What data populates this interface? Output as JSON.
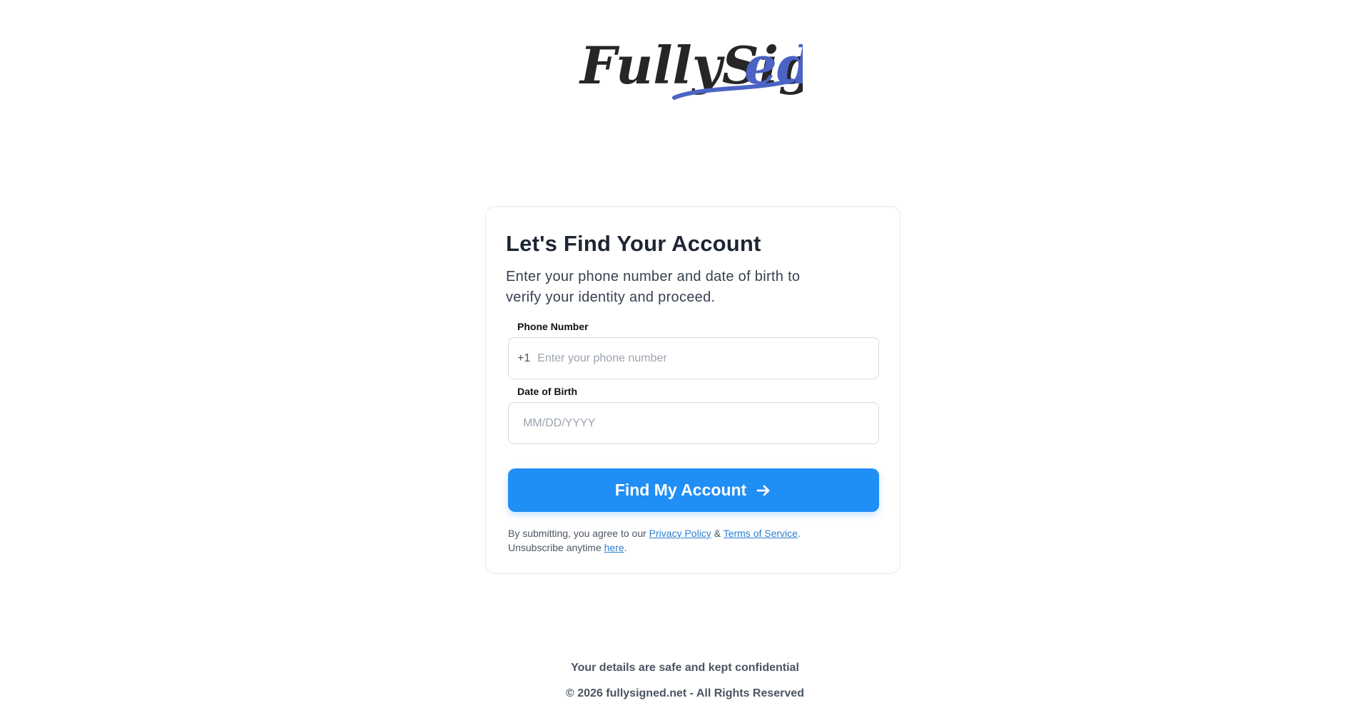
{
  "brand": {
    "name": "FullySigned",
    "primary_color": "#1f8ef5",
    "logo_dark": "#262626",
    "logo_accent": "#4a63c4"
  },
  "card": {
    "title": "Let's Find Your Account",
    "subtitle": "Enter your phone number and date of birth to verify your identity and proceed."
  },
  "phone": {
    "label": "Phone Number",
    "prefix": "+1",
    "placeholder": "Enter your phone number",
    "value": ""
  },
  "dob": {
    "label": "Date of Birth",
    "placeholder": "MM/DD/YYYY",
    "value": ""
  },
  "submit": {
    "label": "Find My Account",
    "icon": "arrow-right-icon"
  },
  "legal": {
    "prefix": "By submitting, you agree to our ",
    "privacy_label": "Privacy Policy",
    "amp": " & ",
    "terms_label": "Terms of Service",
    "period": ".",
    "unsubscribe_prefix": "Unsubscribe anytime ",
    "here_label": "here",
    "end": "."
  },
  "footer": {
    "note": "Your details are safe and kept confidential",
    "copyright": "© 2026 fullysigned.net - All Rights Reserved"
  }
}
